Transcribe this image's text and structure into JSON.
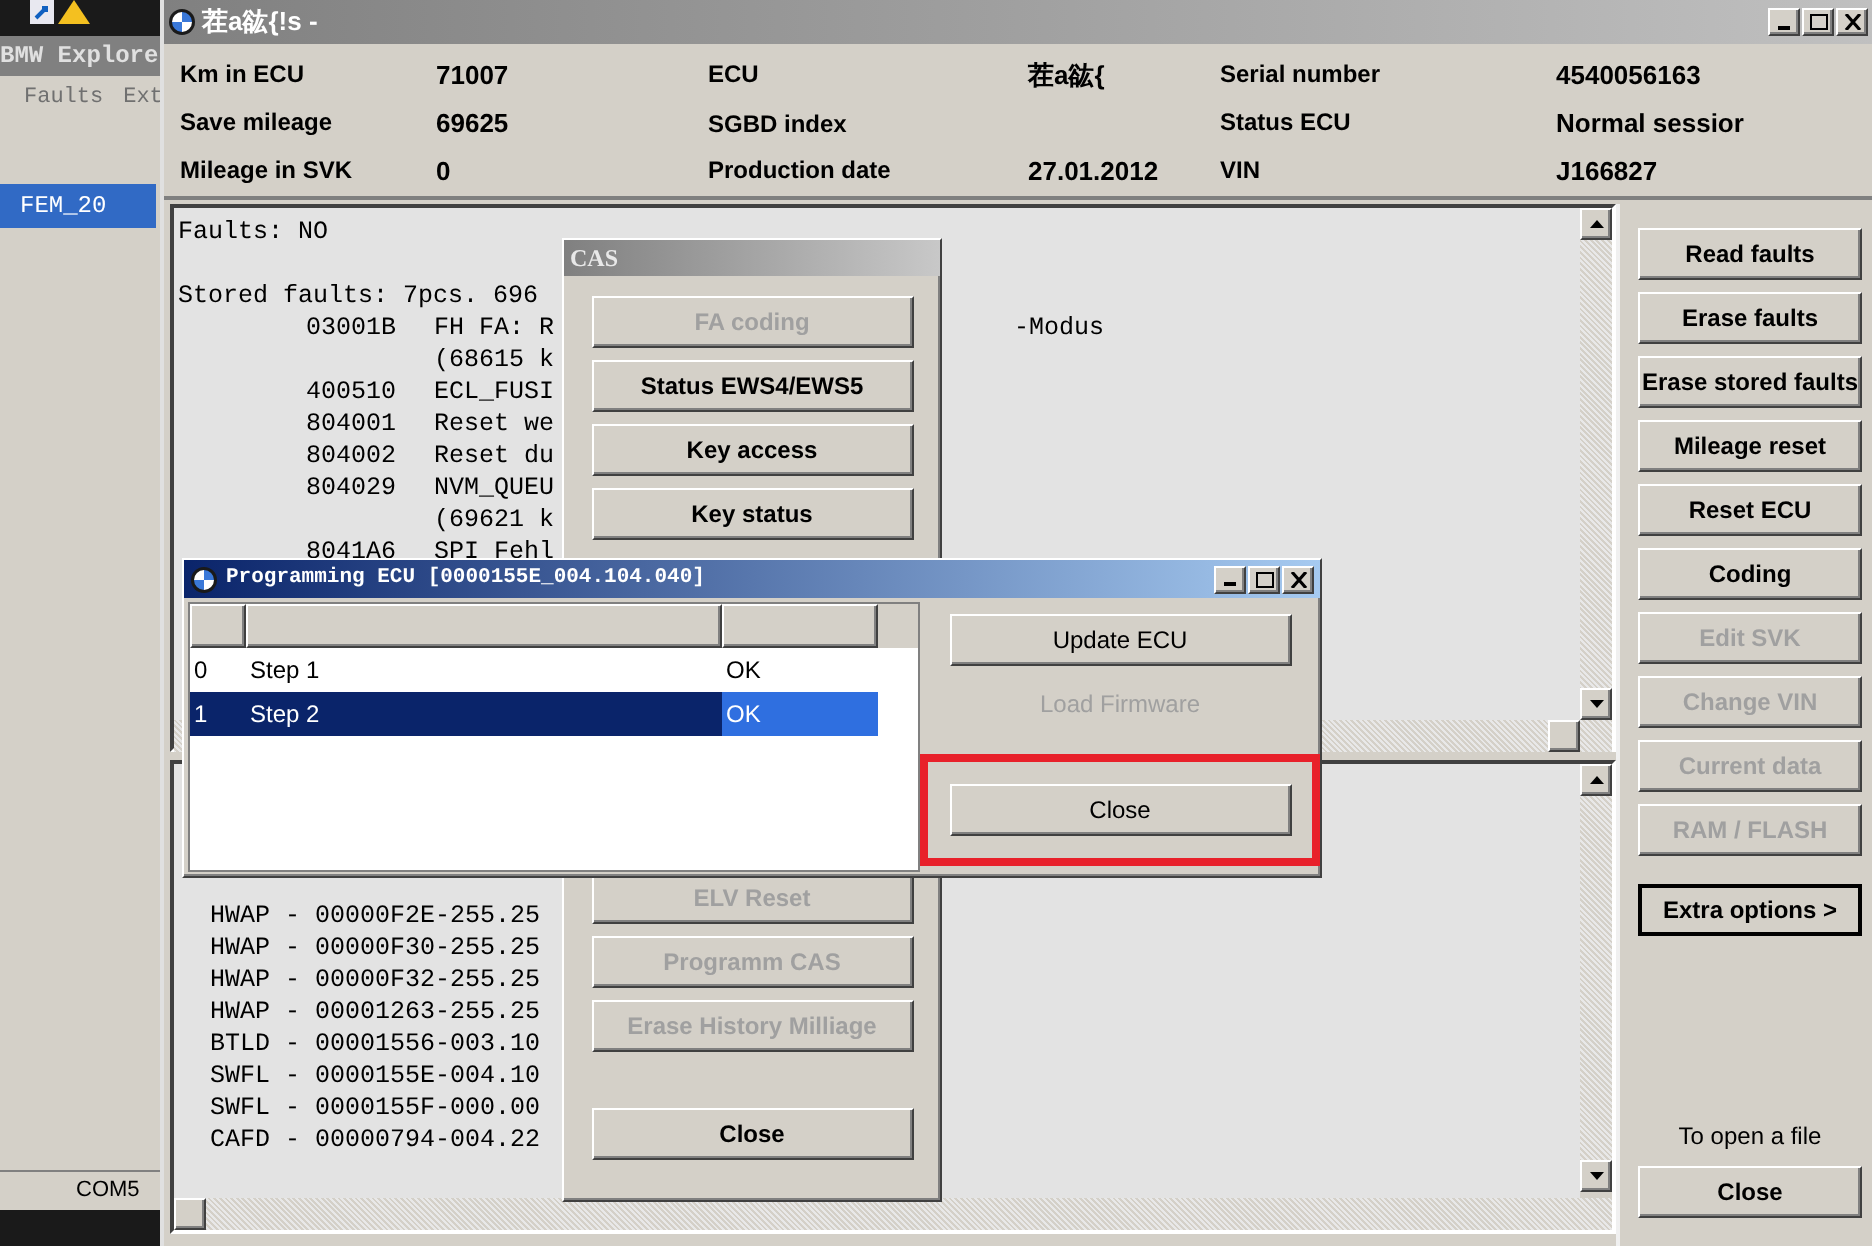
{
  "explorer": {
    "title": "BMW Explore",
    "menu": [
      "Faults",
      "Ext"
    ],
    "tree_items": [
      {
        "label": "FEM_20",
        "selected": true
      }
    ],
    "status_bar": [
      "COM5"
    ]
  },
  "main_window": {
    "title": "茬a谹{!s -",
    "info": [
      [
        {
          "label": "Km in ECU",
          "value": "71007"
        },
        {
          "label": "ECU",
          "value": "茬a谹{"
        },
        {
          "label": "Serial number",
          "value": "4540056163"
        }
      ],
      [
        {
          "label": "Save mileage",
          "value": "69625"
        },
        {
          "label": "SGBD index"
        },
        {
          "label": "Status ECU",
          "value": "Normal sessior"
        }
      ],
      [
        {
          "label": "Mileage in SVK",
          "value": "0"
        },
        {
          "label": "Production date",
          "value": "27.01.2012"
        },
        {
          "label": "VIN",
          "value": "J166827"
        }
      ]
    ],
    "faults_pane": {
      "header": "Faults: NO",
      "stored": "Stored faults: 7pcs. 696",
      "tail": "-Modus",
      "lines": [
        {
          "code": "03001B",
          "text": "FH FA: R"
        },
        {
          "text": "(68615 k"
        },
        {
          "code": "400510",
          "text": "ECL_FUSI"
        },
        {
          "code": "804001",
          "text": "Reset we"
        },
        {
          "code": "804002",
          "text": "Reset du"
        },
        {
          "code": "804029",
          "text": "NVM_QUEU"
        },
        {
          "text": "(69621 k"
        },
        {
          "code": "8041A6",
          "text": "SPI Fehl"
        }
      ]
    },
    "svk_pane": {
      "lines": [
        "HWAP - 00000F2E-255.25",
        "HWAP - 00000F30-255.25",
        "HWAP - 00000F32-255.25",
        "HWAP - 00001263-255.25",
        "BTLD - 00001556-003.10",
        "SWFL - 0000155E-004.10",
        "SWFL - 0000155F-000.00",
        "CAFD - 00000794-004.22"
      ]
    },
    "buttons": [
      {
        "label": "Read faults",
        "disabled": false,
        "default": false
      },
      {
        "label": "Erase faults",
        "disabled": false,
        "default": false
      },
      {
        "label": "Erase stored faults",
        "disabled": false,
        "default": false
      },
      {
        "label": "Mileage reset",
        "disabled": false,
        "default": false
      },
      {
        "label": "Reset ECU",
        "disabled": false,
        "default": false
      },
      {
        "label": "Coding",
        "disabled": false,
        "default": false
      },
      {
        "label": "Edit SVK",
        "disabled": true,
        "default": false
      },
      {
        "label": "Change VIN",
        "disabled": true,
        "default": false
      },
      {
        "label": "Current data",
        "disabled": true,
        "default": false
      },
      {
        "label": "RAM / FLASH",
        "disabled": true,
        "default": false
      },
      {
        "label": "Extra options >",
        "disabled": false,
        "default": true
      }
    ],
    "file_hint": "To open a file",
    "close": "Close"
  },
  "cas_window": {
    "title": "CAS",
    "buttons_top": [
      {
        "label": "FA coding",
        "disabled": true
      },
      {
        "label": "Status EWS4/EWS5",
        "disabled": false
      },
      {
        "label": "Key access",
        "disabled": false
      },
      {
        "label": "Key status",
        "disabled": false
      }
    ],
    "buttons_bottom": [
      {
        "label": "ELV Reset",
        "disabled": true
      },
      {
        "label": "Programm CAS",
        "disabled": true
      },
      {
        "label": "Erase History Milliage",
        "disabled": true
      }
    ],
    "close": "Close"
  },
  "programming_dialog": {
    "title": "Programming ECU [0000155E_004.104.040]",
    "rows": [
      {
        "cells": [
          "0",
          "Step 1",
          "OK"
        ],
        "selected": false
      },
      {
        "cells": [
          "1",
          "Step 2",
          "OK"
        ],
        "selected": true
      }
    ],
    "buttons": [
      {
        "label": "Update ECU",
        "disabled": false
      },
      {
        "label": "Load Firmware",
        "disabled": true
      },
      {
        "label": "Close",
        "disabled": false,
        "highlighted": true
      }
    ]
  }
}
